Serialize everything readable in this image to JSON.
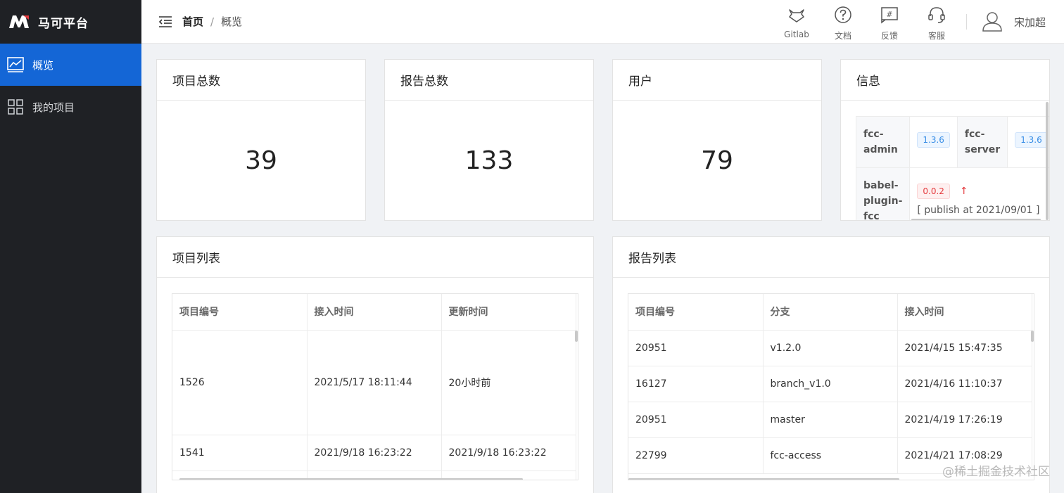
{
  "app": {
    "name": "马可平台",
    "logo_icon": "m-logo-icon",
    "brand_color": "#e4393c"
  },
  "sidebar": {
    "items": [
      {
        "label": "概览",
        "icon": "chart-icon",
        "active": true
      },
      {
        "label": "我的项目",
        "icon": "grid-icon",
        "active": false
      }
    ],
    "active_color": "#1466d6"
  },
  "header": {
    "breadcrumb": [
      "首页",
      "概览"
    ],
    "breadcrumb_sep": "/",
    "tools": [
      {
        "label": "Gitlab",
        "icon": "gitlab-icon"
      },
      {
        "label": "文档",
        "icon": "help-circle-icon"
      },
      {
        "label": "反馈",
        "icon": "feedback-icon"
      },
      {
        "label": "客服",
        "icon": "headset-icon"
      }
    ],
    "user": {
      "name": "宋加超",
      "icon": "user-icon"
    }
  },
  "stats": [
    {
      "title": "项目总数",
      "value": "39"
    },
    {
      "title": "报告总数",
      "value": "133"
    },
    {
      "title": "用户",
      "value": "79"
    }
  ],
  "info": {
    "title": "信息",
    "rows": [
      {
        "k1": "fcc-admin",
        "v1": "1.3.6",
        "k2": "fcc-server",
        "v2": "1.3.6"
      },
      {
        "k1": "babel-plugin-fcc",
        "v1": "0.0.2",
        "note": "[ publish at 2021/09/01 ]"
      }
    ]
  },
  "project_list": {
    "title": "项目列表",
    "columns": [
      "项目编号",
      "接入时间",
      "更新时间"
    ],
    "rows": [
      [
        "1526",
        "2021/5/17 18:11:44",
        "20小时前"
      ],
      [
        "1541",
        "2021/9/18 16:23:22",
        "2021/9/18 16:23:22"
      ]
    ]
  },
  "report_list": {
    "title": "报告列表",
    "columns": [
      "项目编号",
      "分支",
      "接入时间"
    ],
    "rows": [
      [
        "20951",
        "v1.2.0",
        "2021/4/15 15:47:35"
      ],
      [
        "16127",
        "branch_v1.0",
        "2021/4/16 11:10:37"
      ],
      [
        "20951",
        "master",
        "2021/4/19 17:26:19"
      ],
      [
        "22799",
        "fcc-access",
        "2021/4/21 17:08:29"
      ]
    ]
  },
  "watermark": "@稀土掘金技术社区"
}
